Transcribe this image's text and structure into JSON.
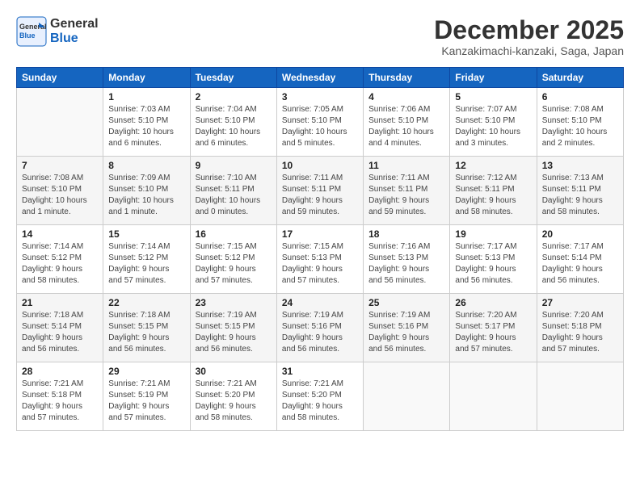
{
  "header": {
    "logo_general": "General",
    "logo_blue": "Blue",
    "month_title": "December 2025",
    "location": "Kanzakimachi-kanzaki, Saga, Japan"
  },
  "calendar": {
    "days_of_week": [
      "Sunday",
      "Monday",
      "Tuesday",
      "Wednesday",
      "Thursday",
      "Friday",
      "Saturday"
    ],
    "weeks": [
      [
        {
          "day": "",
          "info": ""
        },
        {
          "day": "1",
          "info": "Sunrise: 7:03 AM\nSunset: 5:10 PM\nDaylight: 10 hours\nand 6 minutes."
        },
        {
          "day": "2",
          "info": "Sunrise: 7:04 AM\nSunset: 5:10 PM\nDaylight: 10 hours\nand 6 minutes."
        },
        {
          "day": "3",
          "info": "Sunrise: 7:05 AM\nSunset: 5:10 PM\nDaylight: 10 hours\nand 5 minutes."
        },
        {
          "day": "4",
          "info": "Sunrise: 7:06 AM\nSunset: 5:10 PM\nDaylight: 10 hours\nand 4 minutes."
        },
        {
          "day": "5",
          "info": "Sunrise: 7:07 AM\nSunset: 5:10 PM\nDaylight: 10 hours\nand 3 minutes."
        },
        {
          "day": "6",
          "info": "Sunrise: 7:08 AM\nSunset: 5:10 PM\nDaylight: 10 hours\nand 2 minutes."
        }
      ],
      [
        {
          "day": "7",
          "info": "Sunrise: 7:08 AM\nSunset: 5:10 PM\nDaylight: 10 hours\nand 1 minute."
        },
        {
          "day": "8",
          "info": "Sunrise: 7:09 AM\nSunset: 5:10 PM\nDaylight: 10 hours\nand 1 minute."
        },
        {
          "day": "9",
          "info": "Sunrise: 7:10 AM\nSunset: 5:11 PM\nDaylight: 10 hours\nand 0 minutes."
        },
        {
          "day": "10",
          "info": "Sunrise: 7:11 AM\nSunset: 5:11 PM\nDaylight: 9 hours\nand 59 minutes."
        },
        {
          "day": "11",
          "info": "Sunrise: 7:11 AM\nSunset: 5:11 PM\nDaylight: 9 hours\nand 59 minutes."
        },
        {
          "day": "12",
          "info": "Sunrise: 7:12 AM\nSunset: 5:11 PM\nDaylight: 9 hours\nand 58 minutes."
        },
        {
          "day": "13",
          "info": "Sunrise: 7:13 AM\nSunset: 5:11 PM\nDaylight: 9 hours\nand 58 minutes."
        }
      ],
      [
        {
          "day": "14",
          "info": "Sunrise: 7:14 AM\nSunset: 5:12 PM\nDaylight: 9 hours\nand 58 minutes."
        },
        {
          "day": "15",
          "info": "Sunrise: 7:14 AM\nSunset: 5:12 PM\nDaylight: 9 hours\nand 57 minutes."
        },
        {
          "day": "16",
          "info": "Sunrise: 7:15 AM\nSunset: 5:12 PM\nDaylight: 9 hours\nand 57 minutes."
        },
        {
          "day": "17",
          "info": "Sunrise: 7:15 AM\nSunset: 5:13 PM\nDaylight: 9 hours\nand 57 minutes."
        },
        {
          "day": "18",
          "info": "Sunrise: 7:16 AM\nSunset: 5:13 PM\nDaylight: 9 hours\nand 56 minutes."
        },
        {
          "day": "19",
          "info": "Sunrise: 7:17 AM\nSunset: 5:13 PM\nDaylight: 9 hours\nand 56 minutes."
        },
        {
          "day": "20",
          "info": "Sunrise: 7:17 AM\nSunset: 5:14 PM\nDaylight: 9 hours\nand 56 minutes."
        }
      ],
      [
        {
          "day": "21",
          "info": "Sunrise: 7:18 AM\nSunset: 5:14 PM\nDaylight: 9 hours\nand 56 minutes."
        },
        {
          "day": "22",
          "info": "Sunrise: 7:18 AM\nSunset: 5:15 PM\nDaylight: 9 hours\nand 56 minutes."
        },
        {
          "day": "23",
          "info": "Sunrise: 7:19 AM\nSunset: 5:15 PM\nDaylight: 9 hours\nand 56 minutes."
        },
        {
          "day": "24",
          "info": "Sunrise: 7:19 AM\nSunset: 5:16 PM\nDaylight: 9 hours\nand 56 minutes."
        },
        {
          "day": "25",
          "info": "Sunrise: 7:19 AM\nSunset: 5:16 PM\nDaylight: 9 hours\nand 56 minutes."
        },
        {
          "day": "26",
          "info": "Sunrise: 7:20 AM\nSunset: 5:17 PM\nDaylight: 9 hours\nand 57 minutes."
        },
        {
          "day": "27",
          "info": "Sunrise: 7:20 AM\nSunset: 5:18 PM\nDaylight: 9 hours\nand 57 minutes."
        }
      ],
      [
        {
          "day": "28",
          "info": "Sunrise: 7:21 AM\nSunset: 5:18 PM\nDaylight: 9 hours\nand 57 minutes."
        },
        {
          "day": "29",
          "info": "Sunrise: 7:21 AM\nSunset: 5:19 PM\nDaylight: 9 hours\nand 57 minutes."
        },
        {
          "day": "30",
          "info": "Sunrise: 7:21 AM\nSunset: 5:20 PM\nDaylight: 9 hours\nand 58 minutes."
        },
        {
          "day": "31",
          "info": "Sunrise: 7:21 AM\nSunset: 5:20 PM\nDaylight: 9 hours\nand 58 minutes."
        },
        {
          "day": "",
          "info": ""
        },
        {
          "day": "",
          "info": ""
        },
        {
          "day": "",
          "info": ""
        }
      ]
    ]
  }
}
